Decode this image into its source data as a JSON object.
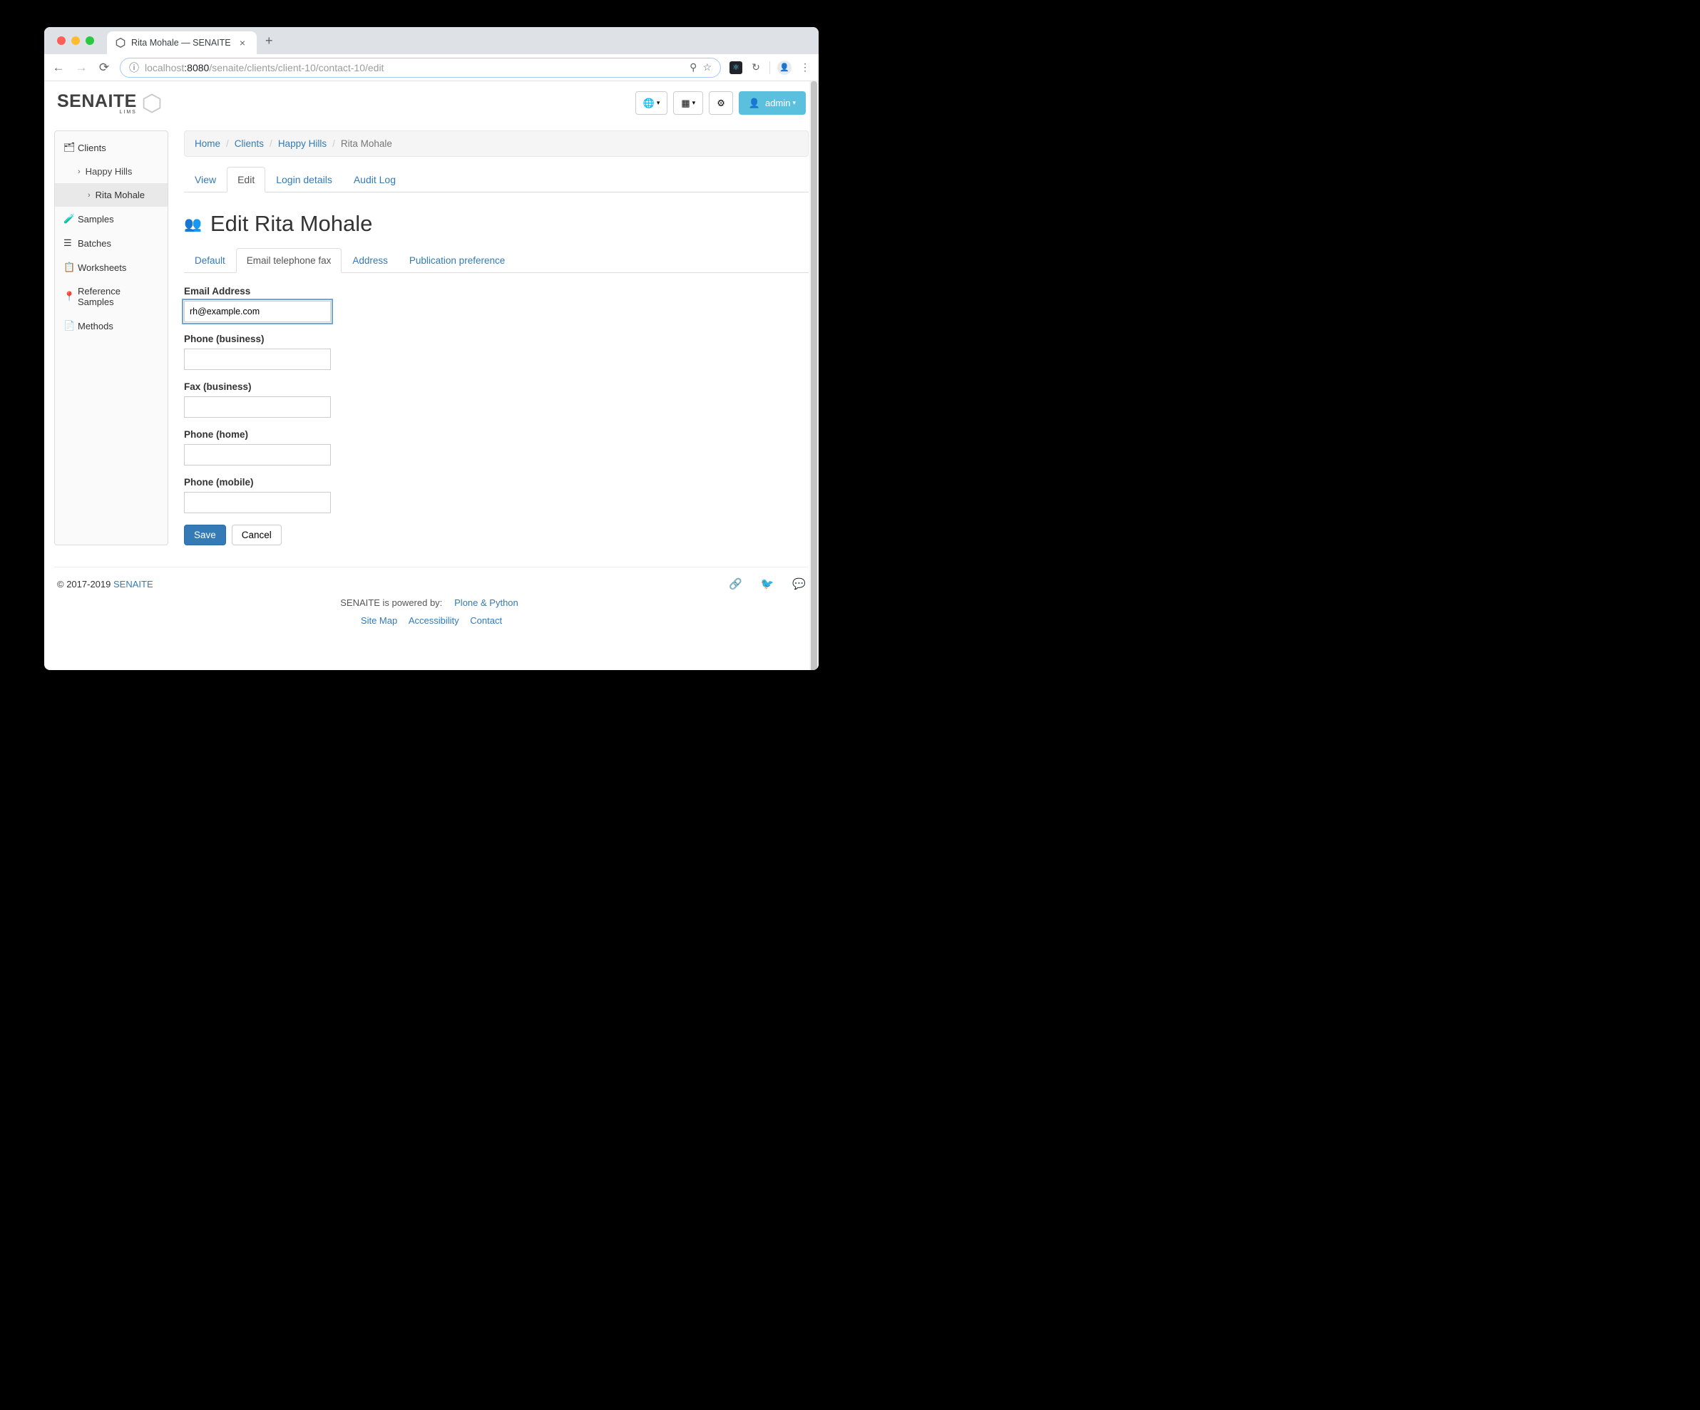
{
  "browser": {
    "tab_title": "Rita Mohale — SENAITE",
    "url_host": "localhost",
    "url_port": ":8080",
    "url_path": "/senaite/clients/client-10/contact-10/edit"
  },
  "logo": {
    "text": "SENAITE",
    "sub": "LIMS"
  },
  "header_buttons": {
    "admin_label": "admin"
  },
  "sidebar": {
    "clients": "Clients",
    "happy_hills": "Happy Hills",
    "rita": "Rita Mohale",
    "samples": "Samples",
    "batches": "Batches",
    "worksheets": "Worksheets",
    "ref_samples": "Reference Samples",
    "methods": "Methods"
  },
  "breadcrumb": {
    "home": "Home",
    "clients": "Clients",
    "happy_hills": "Happy Hills",
    "current": "Rita Mohale"
  },
  "page_tabs": {
    "view": "View",
    "edit": "Edit",
    "login": "Login details",
    "audit": "Audit Log"
  },
  "page_title": "Edit Rita Mohale",
  "sub_tabs": {
    "default": "Default",
    "contact": "Email telephone fax",
    "address": "Address",
    "pub": "Publication preference"
  },
  "form": {
    "email_label": "Email Address",
    "email_value": "rh@example.com",
    "phone_business_label": "Phone (business)",
    "phone_business_value": "",
    "fax_label": "Fax (business)",
    "fax_value": "",
    "phone_home_label": "Phone (home)",
    "phone_home_value": "",
    "phone_mobile_label": "Phone (mobile)",
    "phone_mobile_value": "",
    "save": "Save",
    "cancel": "Cancel"
  },
  "footer": {
    "copyright_prefix": "© 2017-2019 ",
    "senaite": "SENAITE",
    "powered": "SENAITE is powered by:",
    "plone": "Plone & Python",
    "sitemap": "Site Map",
    "accessibility": "Accessibility",
    "contact": "Contact"
  }
}
